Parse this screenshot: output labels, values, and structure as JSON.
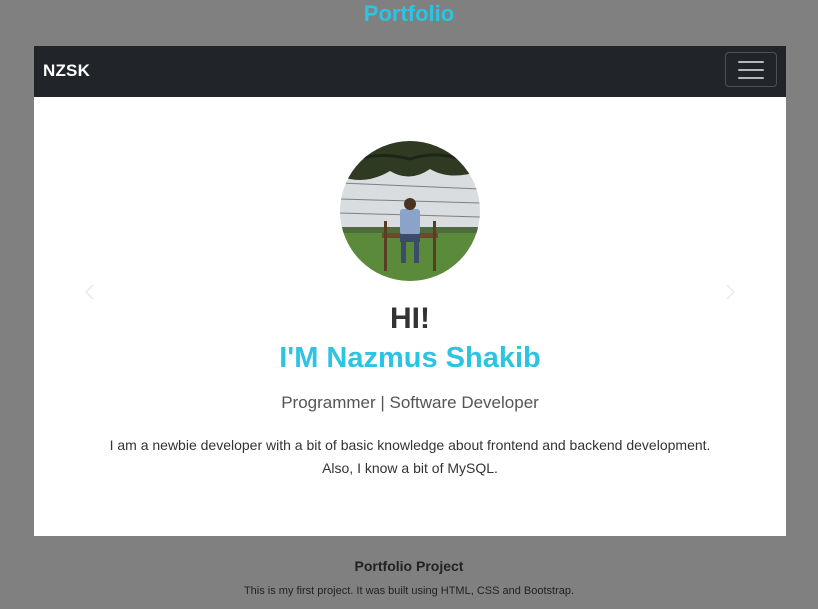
{
  "page": {
    "title": "Portfolio"
  },
  "navbar": {
    "brand": "NZSK",
    "toggle_icon": "hamburger-menu-icon"
  },
  "slide": {
    "greeting": "HI!",
    "name": "I'M Nazmus Shakib",
    "role": "Programmer | Software Developer",
    "description_line1": "I am a newbie developer with a bit of basic knowledge about frontend and backend development.",
    "description_line2": "Also, I know a bit of MySQL."
  },
  "carousel": {
    "prev_icon": "chevron-left-icon",
    "next_icon": "chevron-right-icon"
  },
  "project": {
    "title": "Portfolio Project",
    "description": "This is my first project. It was built using HTML, CSS and Bootstrap."
  },
  "colors": {
    "accent": "#2bc4e2",
    "navbar": "#212529",
    "background": "#808080"
  }
}
